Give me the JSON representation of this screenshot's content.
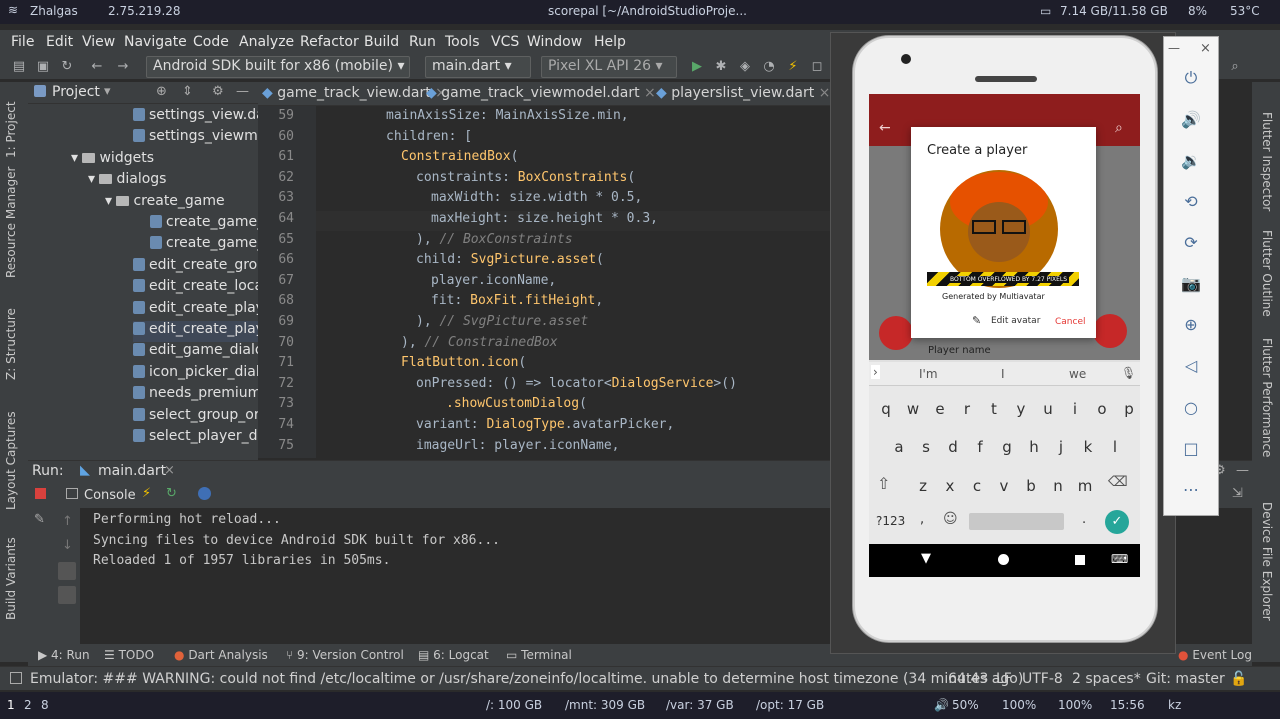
{
  "system_top": {
    "wifi": "Zhalgas",
    "ip": "2.75.219.28",
    "title": "scorepal [~/AndroidStudioProje...",
    "memory": "7.14 GB/11.58 GB",
    "cpu": "8%",
    "temp": "53°C"
  },
  "menu": [
    "File",
    "Edit",
    "View",
    "Navigate",
    "Code",
    "Analyze",
    "Refactor",
    "Build",
    "Run",
    "Tools",
    "VCS",
    "Window",
    "Help"
  ],
  "toolbar": {
    "device": "Android SDK built for x86 (mobile)",
    "config": "main.dart",
    "avd": "Pixel XL API 26",
    "git": "Git:"
  },
  "project": {
    "title": "Project",
    "items": [
      {
        "label": "settings_view.da",
        "type": "file",
        "indent": 3
      },
      {
        "label": "settings_viewmo",
        "type": "file",
        "indent": 3
      },
      {
        "label": "widgets",
        "type": "dir",
        "indent": 1
      },
      {
        "label": "dialogs",
        "type": "dir",
        "indent": 2
      },
      {
        "label": "create_game",
        "type": "dir",
        "indent": 3
      },
      {
        "label": "create_game_",
        "type": "file",
        "indent": 4
      },
      {
        "label": "create_game_",
        "type": "file",
        "indent": 4
      },
      {
        "label": "edit_create_grou",
        "type": "file",
        "indent": 3
      },
      {
        "label": "edit_create_locat",
        "type": "file",
        "indent": 3
      },
      {
        "label": "edit_create_play.",
        "type": "file",
        "indent": 3
      },
      {
        "label": "edit_create_playe",
        "type": "file",
        "indent": 3
      },
      {
        "label": "edit_game_dialo",
        "type": "file",
        "indent": 3
      },
      {
        "label": "icon_picker_dialo",
        "type": "file",
        "indent": 3
      },
      {
        "label": "needs_premium_",
        "type": "file",
        "indent": 3
      },
      {
        "label": "select_group_or_",
        "type": "file",
        "indent": 3
      },
      {
        "label": "select_player_dia",
        "type": "file",
        "indent": 3
      }
    ]
  },
  "editor_tabs": [
    "game_track_view.dart",
    "game_track_viewmodel.dart",
    "playerslist_view.dart"
  ],
  "code": [
    {
      "n": "59",
      "indent": 0,
      "parts": [
        [
          "id",
          "mainAxisSize: MainAxisSize.min,"
        ]
      ]
    },
    {
      "n": "60",
      "indent": 0,
      "parts": [
        [
          "id",
          "children: ["
        ]
      ]
    },
    {
      "n": "61",
      "indent": 1,
      "parts": [
        [
          "cls",
          "ConstrainedBox"
        ],
        [
          "id",
          "("
        ]
      ]
    },
    {
      "n": "62",
      "indent": 2,
      "parts": [
        [
          "id",
          "constraints: "
        ],
        [
          "cls",
          "BoxConstraints"
        ],
        [
          "id",
          "("
        ]
      ]
    },
    {
      "n": "63",
      "indent": 3,
      "parts": [
        [
          "id",
          "maxWidth: size.width * 0.5,"
        ]
      ]
    },
    {
      "n": "64",
      "indent": 3,
      "parts": [
        [
          "id",
          "maxHeight: size.height * 0.3,"
        ]
      ]
    },
    {
      "n": "65",
      "indent": 2,
      "parts": [
        [
          "id",
          "), "
        ],
        [
          "cm",
          "// BoxConstraints"
        ]
      ]
    },
    {
      "n": "66",
      "indent": 2,
      "parts": [
        [
          "id",
          "child: "
        ],
        [
          "cls",
          "SvgPicture.asset"
        ],
        [
          "id",
          "("
        ]
      ]
    },
    {
      "n": "67",
      "indent": 3,
      "parts": [
        [
          "id",
          "player.iconName,"
        ]
      ]
    },
    {
      "n": "68",
      "indent": 3,
      "parts": [
        [
          "id",
          "fit: "
        ],
        [
          "cls",
          "BoxFit.fitHeight"
        ],
        [
          "id",
          ","
        ]
      ]
    },
    {
      "n": "69",
      "indent": 2,
      "parts": [
        [
          "id",
          "), "
        ],
        [
          "cm",
          "// SvgPicture.asset"
        ]
      ]
    },
    {
      "n": "70",
      "indent": 1,
      "parts": [
        [
          "id",
          "), "
        ],
        [
          "cm",
          "// ConstrainedBox"
        ]
      ]
    },
    {
      "n": "71",
      "indent": 1,
      "parts": [
        [
          "cls",
          "FlatButton.icon"
        ],
        [
          "id",
          "("
        ]
      ]
    },
    {
      "n": "72",
      "indent": 2,
      "parts": [
        [
          "id",
          "onPressed: () => locator<"
        ],
        [
          "cls",
          "DialogService"
        ],
        [
          "id",
          ">()"
        ]
      ]
    },
    {
      "n": "73",
      "indent": 4,
      "parts": [
        [
          "cls",
          ".showCustomDialog"
        ],
        [
          "id",
          "("
        ]
      ]
    },
    {
      "n": "74",
      "indent": 2,
      "parts": [
        [
          "id",
          "variant: "
        ],
        [
          "cls",
          "DialogType"
        ],
        [
          "id",
          ".avatarPicker,"
        ]
      ]
    },
    {
      "n": "75",
      "indent": 2,
      "parts": [
        [
          "id",
          "imageUrl: player.iconName,"
        ]
      ]
    }
  ],
  "run": {
    "label": "Run:",
    "tab": "main.dart",
    "console_tab": "Console",
    "lines": [
      "Performing hot reload...",
      "Syncing files to device Android SDK built for x86...",
      "Reloaded 1 of 1957 libraries in 505ms."
    ]
  },
  "bottom_tabs": [
    "4: Run",
    "TODO",
    "Dart Analysis",
    "9: Version Control",
    "6: Logcat",
    "Terminal",
    "Event Log"
  ],
  "left_tabs": [
    "1: Project",
    "Resource Manager",
    "Z: Structure",
    "Layout Captures",
    "Build Variants"
  ],
  "right_tabs": [
    "Flutter Inspector",
    "Flutter Outline",
    "Flutter Performance",
    "Device File Explorer"
  ],
  "status": {
    "message": "Emulator: ### WARNING: could not find /etc/localtime or /usr/share/zoneinfo/localtime. unable to determine host timezone (34 minutes ago)",
    "position": "64:43",
    "line_sep": "LF",
    "encoding": "UTF-8",
    "indent": "2 spaces*",
    "git": "Git: master"
  },
  "system_bottom": {
    "workspaces": [
      "1",
      "2",
      "8"
    ],
    "root": "/: 100 GB",
    "mnt": "/mnt: 309 GB",
    "var": "/var: 37 GB",
    "opt": "/opt: 17 GB",
    "volume": "50%",
    "brightness": "100%",
    "battery": "100%",
    "clock": "15:56",
    "layout": "kz"
  },
  "phone": {
    "dialog_title": "Create a player",
    "overflow_banner": "BOTTOM OVERFLOWED BY 7.27 PIXELS",
    "generated_by": "Generated by Multiavatar",
    "edit_avatar": "Edit avatar",
    "cancel": "Cancel",
    "player_name_hint": "Player name",
    "suggestions": [
      "I'm",
      "I",
      "we"
    ],
    "row1": [
      "q",
      "w",
      "e",
      "r",
      "t",
      "y",
      "u",
      "i",
      "o",
      "p"
    ],
    "row2": [
      "a",
      "s",
      "d",
      "f",
      "g",
      "h",
      "j",
      "k",
      "l"
    ],
    "row3": [
      "z",
      "x",
      "c",
      "v",
      "b",
      "n",
      "m"
    ],
    "sym_key": "?123",
    "comma": ",",
    "period": "."
  },
  "colors": {
    "app_bar": "#8e1d1d",
    "fab": "#c62828",
    "avatar_hair": "#e65100",
    "cancel_text": "#e53935",
    "keyword": "#cc7832",
    "class": "#ffc66d"
  }
}
